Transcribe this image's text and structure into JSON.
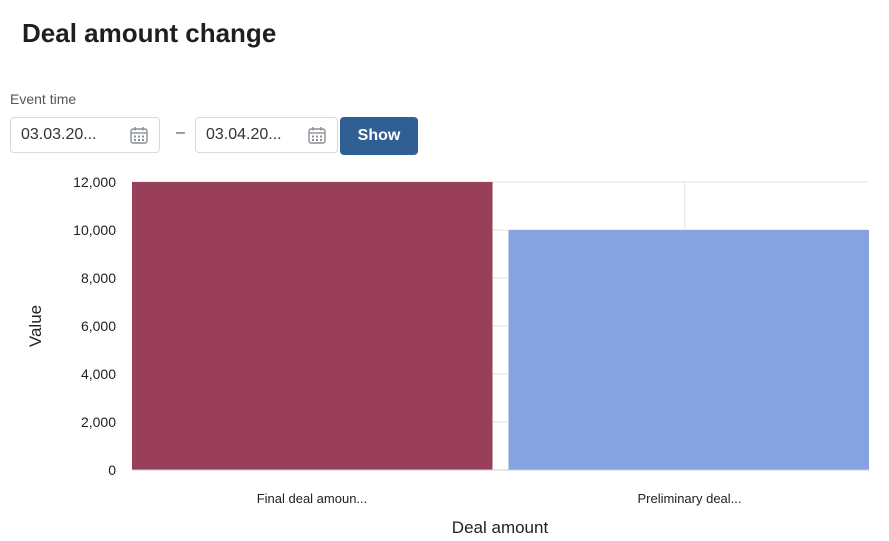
{
  "header": {
    "title": "Deal amount change"
  },
  "filter": {
    "label": "Event time",
    "date_from": "03.03.20...",
    "date_to": "03.04.20...",
    "separator": "–",
    "show_label": "Show",
    "accent_color": "#2f5f93"
  },
  "chart_data": {
    "type": "bar",
    "categories": [
      "Final deal amoun...",
      "Preliminary deal..."
    ],
    "values": [
      12000,
      10000
    ],
    "colors": [
      "#9a3f5a",
      "#84a3e0"
    ],
    "xlabel": "Deal amount",
    "ylabel": "Value",
    "ylim": [
      0,
      12000
    ],
    "yticks": [
      0,
      2000,
      4000,
      6000,
      8000,
      10000,
      12000
    ],
    "ytick_labels": [
      "0",
      "2,000",
      "4,000",
      "6,000",
      "8,000",
      "10,000",
      "12,000"
    ],
    "grid": true
  }
}
